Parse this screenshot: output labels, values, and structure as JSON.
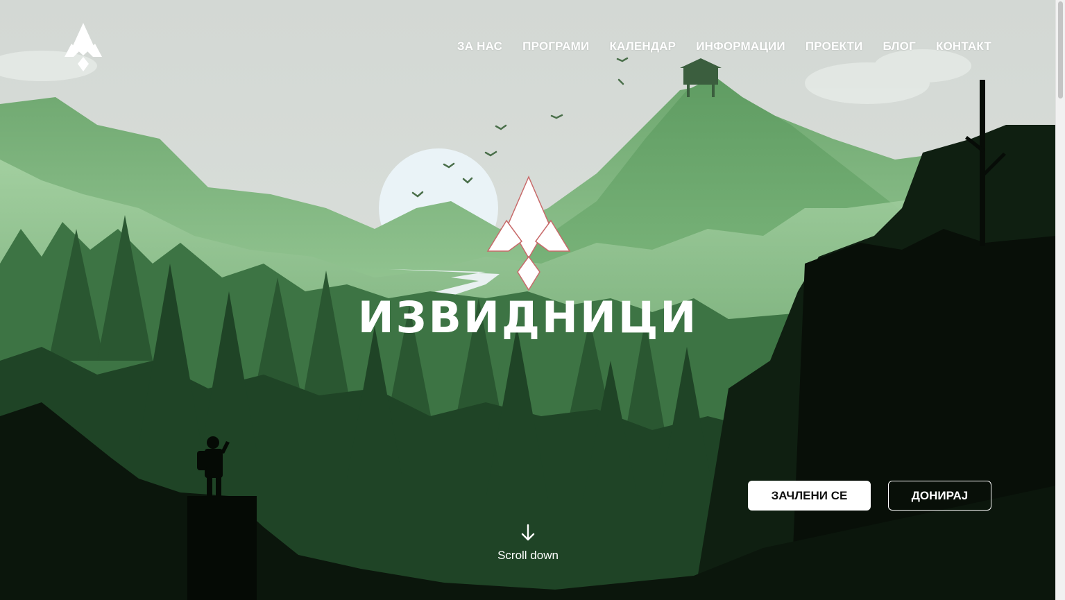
{
  "nav": {
    "logo_icon": "scouts-logo-icon",
    "items": [
      {
        "label": "ЗА НАС"
      },
      {
        "label": "ПРОГРАМИ"
      },
      {
        "label": "КАЛЕНДАР"
      },
      {
        "label": "ИНФОРМАЦИИ"
      },
      {
        "label": "ПРОЕКТИ"
      },
      {
        "label": "БЛОГ"
      },
      {
        "label": "КОНТАКТ"
      }
    ]
  },
  "hero": {
    "brand_name": "ИЗВИДНИЦИ",
    "emblem_icon": "scouts-emblem-icon",
    "join_button": "ЗАЧЛЕНИ СЕ",
    "donate_button": "ДОНИРАЈ",
    "scroll_label": "Scroll down",
    "scroll_icon": "arrow-down-icon"
  },
  "colors": {
    "sky": "#d7dcd8",
    "mountain_light": "#8fc58f",
    "forest_mid": "#3e7a45",
    "forest_dark": "#1e3e23",
    "button_bg": "#ffffff",
    "text": "#ffffff"
  }
}
